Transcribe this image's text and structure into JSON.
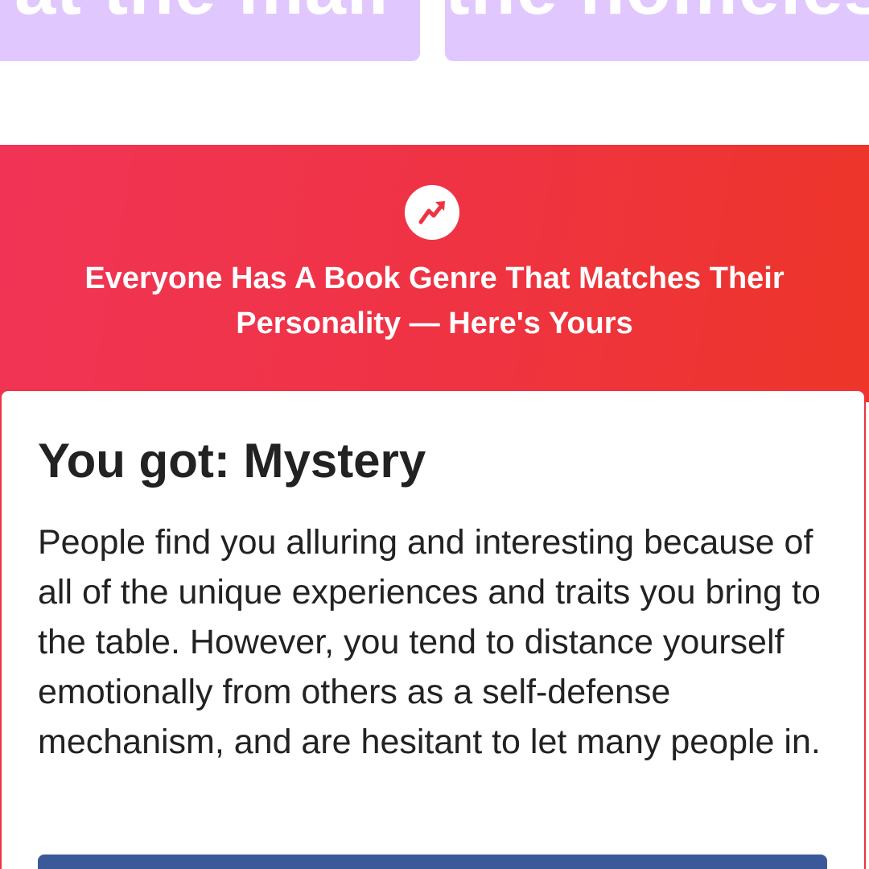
{
  "answer_tiles": [
    {
      "text": "at the mall"
    },
    {
      "text": "the homeless"
    }
  ],
  "banner": {
    "icon": "trending-arrow-icon",
    "title": "Everyone Has A Book Genre That Matches Their Personality — Here's Yours"
  },
  "result": {
    "heading": "You got: Mystery",
    "description": "People find you alluring and interesting because of all of the unique experiences and traits you bring to the table. However, you tend to distance yourself emotionally from others as a self-defense mechanism, and are hesitant to let many people in."
  },
  "colors": {
    "tile": "#e0c8ff",
    "banner": "#ef3342",
    "share_button": "#3b5998",
    "text": "#222222"
  }
}
